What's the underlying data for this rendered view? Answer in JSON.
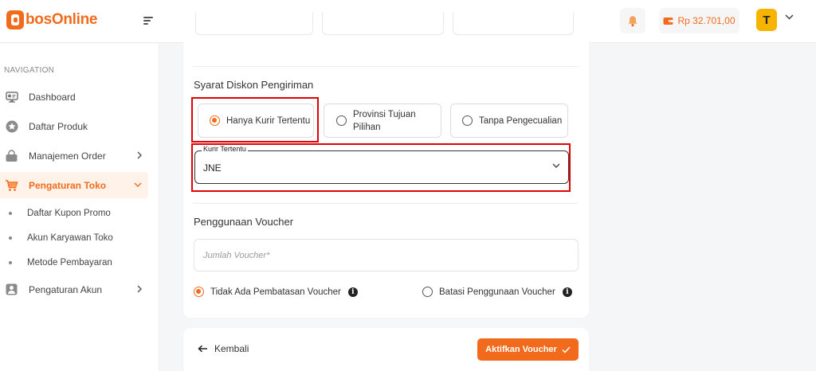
{
  "app": {
    "logo_text": "bosOnline",
    "balance": "Rp 32.701,00",
    "avatar_initial": "T",
    "accent_color": "#f26b1d"
  },
  "sidebar": {
    "heading": "NAVIGATION",
    "items": [
      {
        "label": "Dashboard",
        "icon": "dashboard-icon"
      },
      {
        "label": "Daftar Produk",
        "icon": "star-icon"
      },
      {
        "label": "Manajemen Order",
        "icon": "bag-icon",
        "chevron": "right"
      },
      {
        "label": "Pengaturan Toko",
        "icon": "cart-icon",
        "chevron": "down",
        "active": true
      },
      {
        "label": "Pengaturan Akun",
        "icon": "user-icon",
        "chevron": "right"
      }
    ],
    "sub_items": [
      {
        "label": "Daftar Kupon Promo"
      },
      {
        "label": "Akun Karyawan Toko"
      },
      {
        "label": "Metode Pembayaran"
      }
    ]
  },
  "form": {
    "shipping_title": "Syarat Diskon Pengiriman",
    "shipping_options": [
      {
        "label": "Hanya Kurir Tertentu",
        "checked": true
      },
      {
        "label": "Provinsi Tujuan Pilihan",
        "checked": false
      },
      {
        "label": "Tanpa Pengecualian",
        "checked": false
      }
    ],
    "courier_select": {
      "label": "Kurir Tertentu",
      "value": "JNE"
    },
    "usage_title": "Penggunaan Voucher",
    "voucher_count_placeholder": "Jumlah Voucher*",
    "usage_options": [
      {
        "label": "Tidak Ada Pembatasan Voucher",
        "checked": true
      },
      {
        "label": "Batasi Penggunaan Voucher",
        "checked": false
      }
    ]
  },
  "footer": {
    "back_label": "Kembali",
    "submit_label": "Aktifkan Voucher"
  }
}
